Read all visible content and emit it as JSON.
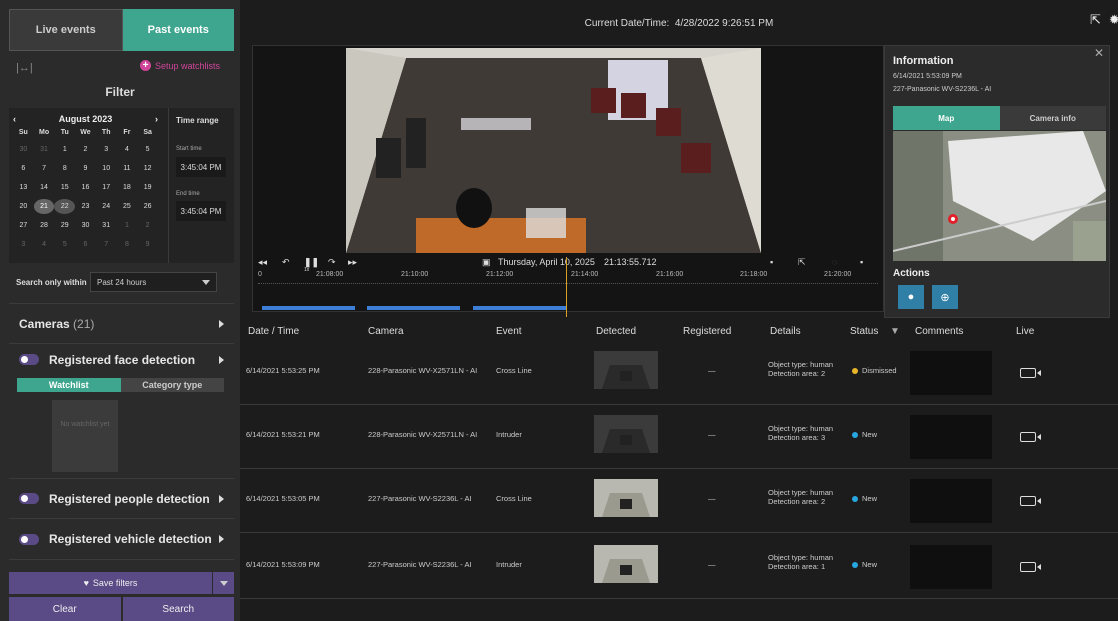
{
  "tabs": {
    "live": "Live events",
    "past": "Past events"
  },
  "filter": {
    "title": "Filter",
    "setup": "Setup watchlists",
    "collapse": "|↔|"
  },
  "calendar": {
    "month": "August 2023",
    "days_header": [
      "Su",
      "Mo",
      "Tu",
      "We",
      "Th",
      "Fr",
      "Sa"
    ],
    "days": [
      "30",
      "31",
      "1",
      "2",
      "3",
      "4",
      "5",
      "6",
      "7",
      "8",
      "9",
      "10",
      "11",
      "12",
      "13",
      "14",
      "15",
      "16",
      "17",
      "18",
      "19",
      "20",
      "21",
      "22",
      "23",
      "24",
      "25",
      "26",
      "27",
      "28",
      "29",
      "30",
      "31",
      "1",
      "2",
      "3",
      "4",
      "5",
      "6",
      "7",
      "8",
      "9"
    ]
  },
  "time_range": {
    "title": "Time range",
    "start_label": "Start time",
    "start": "3:45:04 PM",
    "end_label": "End time",
    "end": "3:45:04 PM"
  },
  "search_within": {
    "label": "Search only within",
    "value": "Past 24 hours"
  },
  "sections": {
    "cameras": "Cameras",
    "cameras_count": "(21)",
    "face": "Registered face detection",
    "people": "Registered people detection",
    "vehicle": "Registered vehicle detection"
  },
  "watchlist_tabs": {
    "watchlist": "Watchlist",
    "category": "Category type"
  },
  "no_watchlist": "No watchlist yet",
  "buttons": {
    "save": "Save filters",
    "clear": "Clear",
    "search": "Search"
  },
  "topbar": {
    "label": "Current Date/Time:",
    "value": "4/28/2022 9:26:51 PM"
  },
  "player": {
    "date": "Thursday, April 10, 2025",
    "time": "21:13:55.712",
    "speed": "1x",
    "ruler": [
      "0",
      "21:08:00",
      "21:10:00",
      "21:12:00",
      "21:14:00",
      "21:16:00",
      "21:18:00",
      "21:20:00"
    ]
  },
  "info": {
    "title": "Information",
    "datetime": "6/14/2021 5:53:09 PM",
    "camera": "227-Panasonic WV-S2236L - AI",
    "tab_map": "Map",
    "tab_camera": "Camera info",
    "actions": "Actions"
  },
  "table": {
    "headers": [
      "Date / Time",
      "Camera",
      "Event",
      "Detected",
      "Registered",
      "Details",
      "Status",
      "Comments",
      "Live"
    ],
    "rows": [
      {
        "datetime": "6/14/2021 5:53:25 PM",
        "camera": "228-Parasonic WV-X2571LN - AI",
        "event": "Cross Line",
        "registered": "—",
        "details1": "Object type: human",
        "details2": "Detection area: 2",
        "status": "Dismissed",
        "status_color": "#e8b628"
      },
      {
        "datetime": "6/14/2021 5:53:21 PM",
        "camera": "228-Parasonic WV-X2571LN - AI",
        "event": "Intruder",
        "registered": "—",
        "details1": "Object type: human",
        "details2": "Detection area: 3",
        "status": "New",
        "status_color": "#27a6e0"
      },
      {
        "datetime": "6/14/2021 5:53:05 PM",
        "camera": "227-Parasonic WV-S2236L - AI",
        "event": "Cross Line",
        "registered": "—",
        "details1": "Object type: human",
        "details2": "Detection area: 2",
        "status": "New",
        "status_color": "#27a6e0"
      },
      {
        "datetime": "6/14/2021 5:53:09 PM",
        "camera": "227-Parasonic WV-S2236L - AI",
        "event": "Intruder",
        "registered": "—",
        "details1": "Object type: human",
        "details2": "Detection area: 1",
        "status": "New",
        "status_color": "#27a6e0"
      }
    ]
  },
  "colors": {
    "accent": "#3ea58e",
    "purple": "#5a4a86",
    "magenta": "#d0459a",
    "timeline": "#3d7fd6",
    "playhead": "#d9a124"
  }
}
